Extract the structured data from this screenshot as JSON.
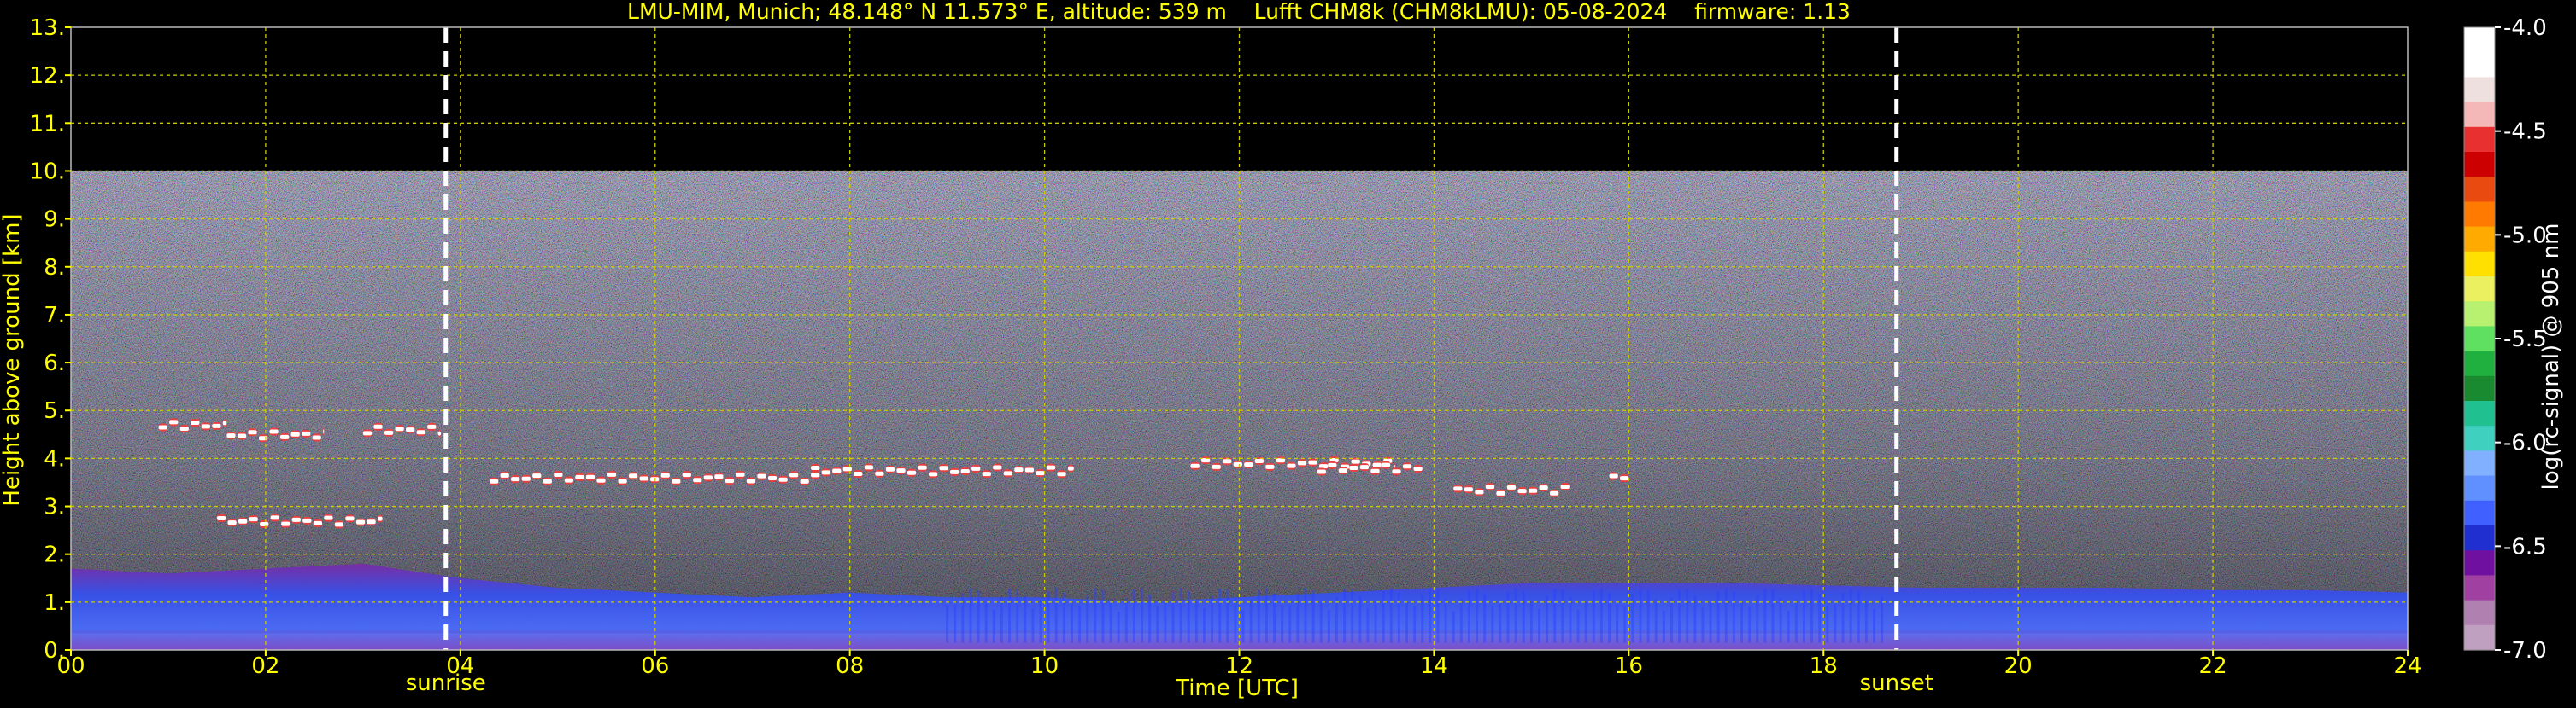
{
  "chart_data": {
    "type": "heatmap",
    "title": "LMU-MIM, Munich; 48.148° N 11.573° E, altitude: 539 m    Lufft CHM8k (CHM8kLMU): 05-08-2024    firmware: 1.13",
    "xlabel": "Time [UTC]",
    "ylabel": "Height above ground [km]",
    "xlim": [
      0,
      24
    ],
    "ylim": [
      0,
      13
    ],
    "x_ticks": [
      "00",
      "02",
      "04",
      "06",
      "08",
      "10",
      "12",
      "14",
      "16",
      "18",
      "20",
      "22",
      "24"
    ],
    "y_ticks": [
      "0.",
      "1.",
      "2.",
      "3.",
      "4.",
      "5.",
      "6.",
      "7.",
      "8.",
      "9.",
      "10.",
      "11.",
      "12.",
      "13."
    ],
    "grid": true,
    "signal_top_km": 10,
    "sun_events": [
      {
        "label": "sunrise",
        "time": 3.85
      },
      {
        "label": "sunset",
        "time": 18.75
      }
    ],
    "colorbar": {
      "label": "log(rc-signal) @ 905 nm",
      "ticks": [
        "-4.0",
        "-4.5",
        "-5.0",
        "-5.5",
        "-6.0",
        "-6.5",
        "-7.0"
      ],
      "range": [
        -7.0,
        -4.0
      ],
      "colors": [
        "#ffffff",
        "#ffffff",
        "#efe0e0",
        "#f4b8b8",
        "#e83030",
        "#cc0000",
        "#e84a10",
        "#ff7a00",
        "#ffaa00",
        "#ffe000",
        "#eaf060",
        "#b8f070",
        "#60e060",
        "#20b040",
        "#1a8a30",
        "#20c090",
        "#40d0c0",
        "#80b0ff",
        "#6090ff",
        "#4060ff",
        "#2030d0",
        "#7010a0",
        "#a040a0",
        "#b080b0",
        "#c0a0c0"
      ]
    },
    "boundary_layer_km": [
      [
        0,
        1.7
      ],
      [
        1,
        1.6
      ],
      [
        2,
        1.7
      ],
      [
        3,
        1.8
      ],
      [
        4,
        1.5
      ],
      [
        5,
        1.3
      ],
      [
        6,
        1.2
      ],
      [
        7,
        1.1
      ],
      [
        8,
        1.2
      ],
      [
        9,
        1.1
      ],
      [
        10,
        1.1
      ],
      [
        11,
        1.0
      ],
      [
        12,
        1.1
      ],
      [
        13,
        1.2
      ],
      [
        14,
        1.3
      ],
      [
        15,
        1.4
      ],
      [
        16,
        1.4
      ],
      [
        17,
        1.4
      ],
      [
        18,
        1.35
      ],
      [
        19,
        1.3
      ],
      [
        20,
        1.3
      ],
      [
        21,
        1.3
      ],
      [
        22,
        1.25
      ],
      [
        23,
        1.25
      ],
      [
        24,
        1.2
      ]
    ],
    "cloud_layers": [
      {
        "start": 0.9,
        "end": 1.6,
        "height": 4.7
      },
      {
        "start": 1.6,
        "end": 2.6,
        "height": 4.5
      },
      {
        "start": 3.0,
        "end": 3.8,
        "height": 4.6
      },
      {
        "start": 1.5,
        "end": 3.2,
        "height": 2.7
      },
      {
        "start": 4.3,
        "end": 7.7,
        "height": 3.6
      },
      {
        "start": 7.6,
        "end": 10.3,
        "height": 3.75
      },
      {
        "start": 11.5,
        "end": 13.6,
        "height": 3.9
      },
      {
        "start": 12.8,
        "end": 13.9,
        "height": 3.8
      },
      {
        "start": 14.2,
        "end": 15.4,
        "height": 3.35
      },
      {
        "start": 15.8,
        "end": 16.0,
        "height": 3.6
      }
    ]
  }
}
